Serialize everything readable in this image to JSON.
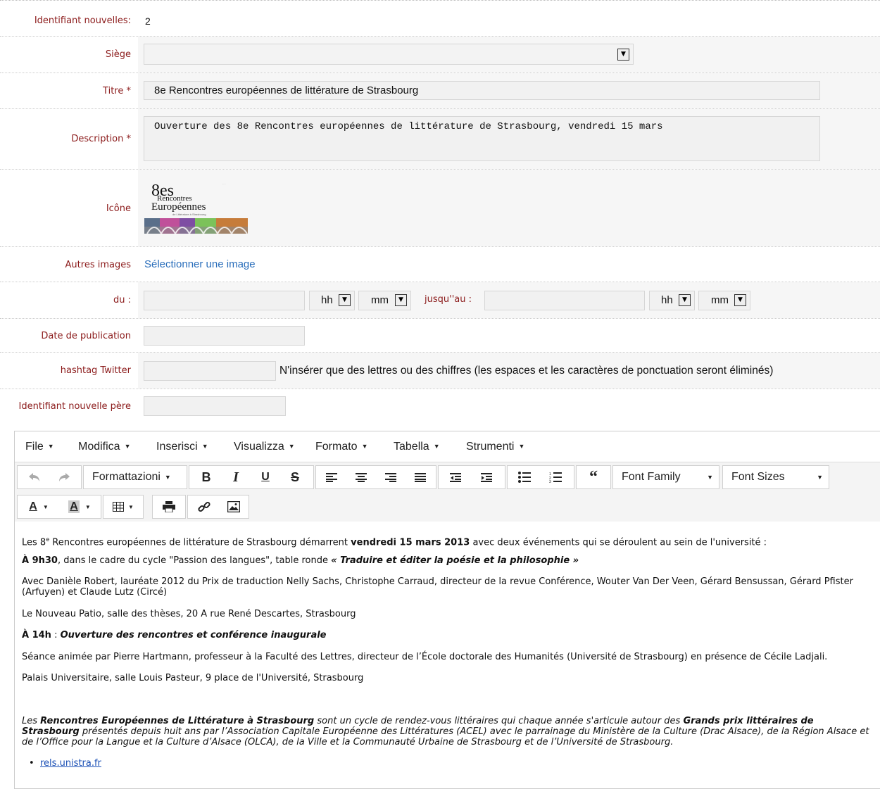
{
  "form": {
    "id_label": "Identifiant nouvelles:",
    "id_value": "2",
    "siege_label": "Siège",
    "titre_label": "Titre *",
    "titre_value": "8e Rencontres européennes de littérature de Strasbourg",
    "description_label": "Description *",
    "description_value": "Ouverture des 8e Rencontres européennes de littérature de Strasbourg, vendredi 15 mars",
    "icone_label": "Icône",
    "autres_images_label": "Autres images",
    "autres_images_link": "Sélectionner une image",
    "du_label": "du :",
    "hh": "hh",
    "mm": "mm",
    "jusqu_label": "jusqu''au :",
    "date_pub_label": "Date de publication",
    "hashtag_label": "hashtag Twitter",
    "hashtag_hint": "N'insérer que des lettres ou des chiffres (les espaces et les caractères de ponctuation seront éliminés)",
    "parent_label": "Identifiant nouvelle père"
  },
  "logo": {
    "line1": "8es",
    "line2": "Rencontres",
    "line3": "Européennes",
    "line4": "de Littérature à Strasbourg"
  },
  "editor": {
    "menu": [
      "File",
      "Modifica",
      "Inserisci",
      "Visualizza",
      "Formato",
      "Tabella",
      "Strumenti"
    ],
    "formats_label": "Formattazioni",
    "font_family_label": "Font Family",
    "font_sizes_label": "Font Sizes",
    "p1_a": "Les 8",
    "p1_sup": "e",
    "p1_b": " Rencontres européennes de littérature de Strasbourg démarrent ",
    "p1_bold": "vendredi 15 mars 2013",
    "p1_c": " avec deux événements qui se déroulent au sein de l'université :",
    "p2_bold": "À 9h30",
    "p2_a": ", dans le cadre du cycle \"Passion des langues\", table ronde ",
    "p2_bi": "« Traduire et éditer la poésie et la philosophie »",
    "p3": "Avec Danièle Robert, lauréate 2012 du Prix de traduction Nelly Sachs, Christophe Carraud, directeur de la revue Conférence, Wouter Van Der Veen, Gérard Bensussan, Gérard Pfister (Arfuyen) et Claude Lutz (Circé)",
    "p4": "Le Nouveau Patio, salle des thèses, 20 A rue René Descartes, Strasbourg",
    "p5_bold": "À 14h",
    "p5_a": " : ",
    "p5_bi": "Ouverture des rencontres et conférence inaugurale",
    "p6": "Séance animée par Pierre Hartmann, professeur à la Faculté des Lettres, directeur de l’École doctorale des Humanités (Université de Strasbourg) en présence de Cécile Ladjali.",
    "p7": "Palais Universitaire, salle Louis Pasteur, 9 place de l'Université, Strasbourg",
    "p8_a": "Les ",
    "p8_b1": "Rencontres Européennes de Littérature à Strasbourg",
    "p8_b": " sont un cycle de rendez-vous littéraires qui chaque année s'articule autour des ",
    "p8_b2": "Grands prix littéraires de Strasbourg",
    "p8_c": " présentés depuis huit ans par l’Association Capitale Européenne des Littératures (ACEL) avec le parrainage du Ministère de la Culture (Drac Alsace), de la Région Alsace et de l’Office pour la Langue et la Culture d’Alsace (OLCA), de la Ville et la Communauté Urbaine de Strasbourg et de l’Université de Strasbourg.",
    "link": "rels.unistra.fr"
  }
}
